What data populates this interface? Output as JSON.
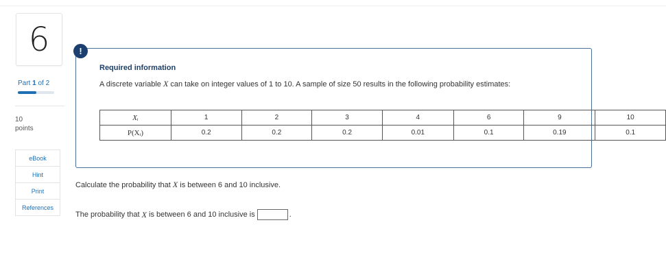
{
  "question": {
    "number": "6"
  },
  "part": {
    "label": "Part",
    "current": "1",
    "of_label": "of 2",
    "progress": 0.5
  },
  "points": {
    "value": "10",
    "label": "points"
  },
  "sidebar_buttons": [
    "eBook",
    "Hint",
    "Print",
    "References"
  ],
  "info": {
    "icon": "!",
    "title": "Required information",
    "text_pre": "A discrete variable ",
    "var": "X",
    "text_post": " can take on integer values of 1 to 10. A sample of size 50 results in the following probability estimates:"
  },
  "table": {
    "row1_header": "Xᵢ",
    "row2_header": "P(Xᵢ)",
    "x": [
      "1",
      "2",
      "3",
      "4",
      "6",
      "9",
      "10"
    ],
    "p": [
      "0.2",
      "0.2",
      "0.2",
      "0.01",
      "0.1",
      "0.19",
      "0.1"
    ]
  },
  "question_text": {
    "pre": "Calculate the probability that ",
    "var": "X",
    "post": " is between 6 and 10 inclusive."
  },
  "answer": {
    "pre": "The probability that ",
    "var": "X",
    "post": " is between 6 and 10 inclusive is",
    "end": ".",
    "value": ""
  },
  "colors": {
    "accent": "#1f6fb5",
    "alert": "#1b3f6e",
    "border": "#4a6f96"
  }
}
